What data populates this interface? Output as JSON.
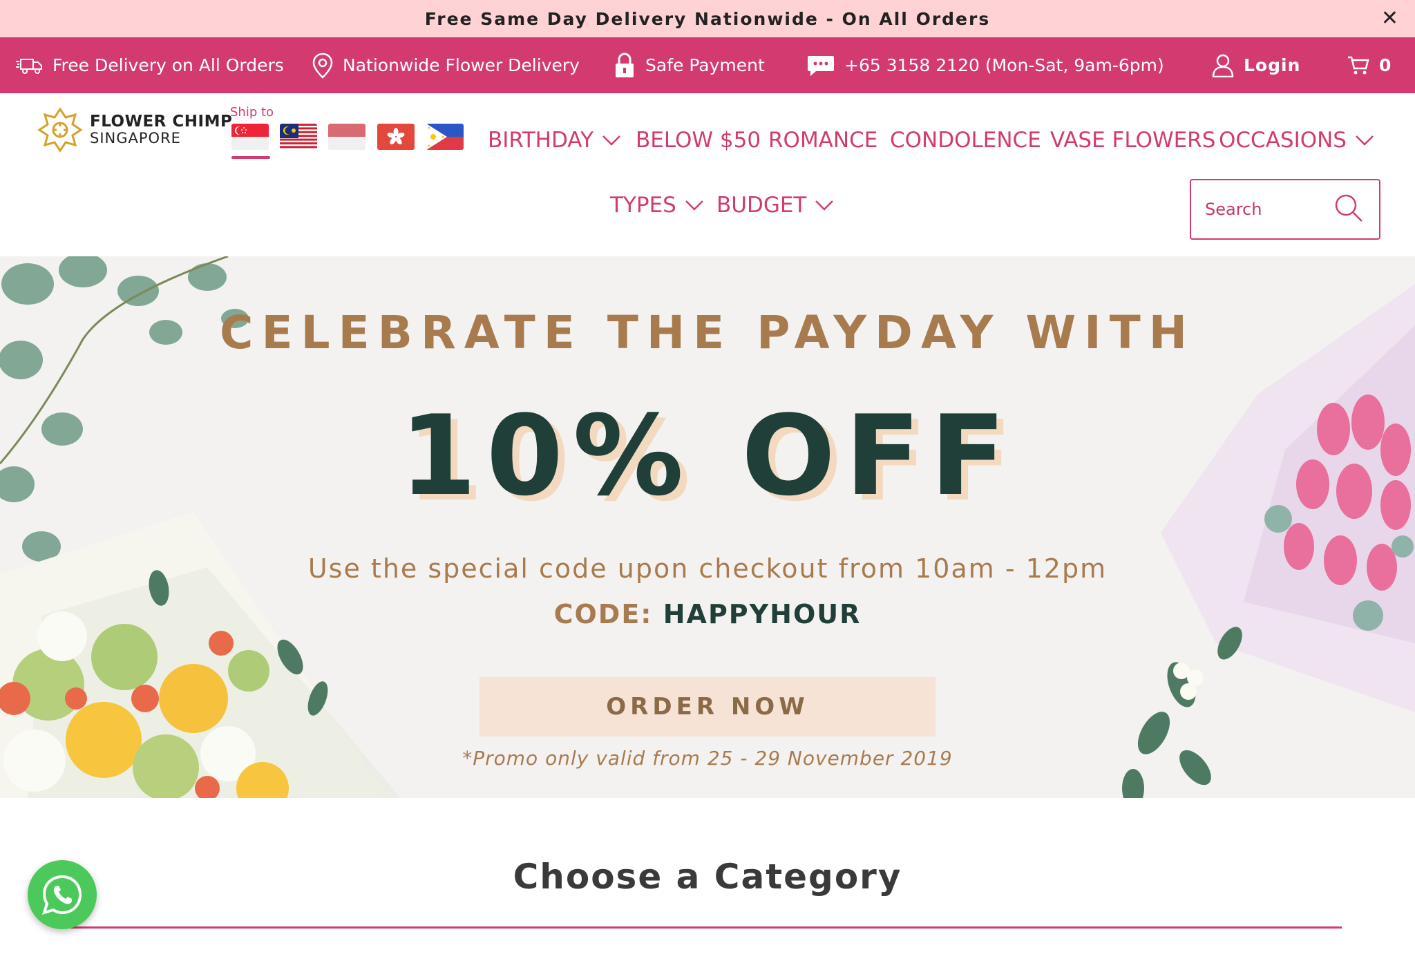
{
  "announcement": {
    "text": "Free Same Day Delivery Nationwide - On All Orders",
    "close_icon": "close-icon"
  },
  "infobar": {
    "delivery": "Free Delivery on All Orders",
    "nationwide": "Nationwide Flower Delivery",
    "payment": "Safe Payment",
    "phone": "+65 3158 2120 (Mon-Sat, 9am-6pm)",
    "login": "Login",
    "cart_count": "0"
  },
  "logo": {
    "line1": "FLOWER CHIMP",
    "line2": "SINGAPORE"
  },
  "ship_to": {
    "label": "Ship to",
    "flags": [
      "singapore-flag",
      "malaysia-flag",
      "indonesia-flag",
      "hong-kong-flag",
      "philippines-flag"
    ],
    "selected": "singapore-flag"
  },
  "nav": {
    "birthday": "BIRTHDAY",
    "below50": "BELOW $50",
    "romance": "ROMANCE",
    "condolence": "CONDOLENCE",
    "vase": "VASE FLOWERS",
    "occasions": "OCCASIONS",
    "types": "TYPES",
    "budget": "BUDGET"
  },
  "search": {
    "placeholder": "Search"
  },
  "banner": {
    "headline": "CELEBRATE THE PAYDAY WITH",
    "offer": "10% OFF",
    "subtext": "Use the special code upon checkout from 10am - 12pm",
    "code_label": "CODE:",
    "code_value": "HAPPYHOUR",
    "cta": "ORDER NOW",
    "promo": "*Promo only valid from 25 - 29 November 2019"
  },
  "category": {
    "title": "Choose a Category"
  },
  "colors": {
    "brand": "#d23a70",
    "announce_bg": "#ffd3d6",
    "banner_green": "#1f3f38",
    "banner_gold": "#a87b4f",
    "whatsapp": "#4bc95a"
  }
}
